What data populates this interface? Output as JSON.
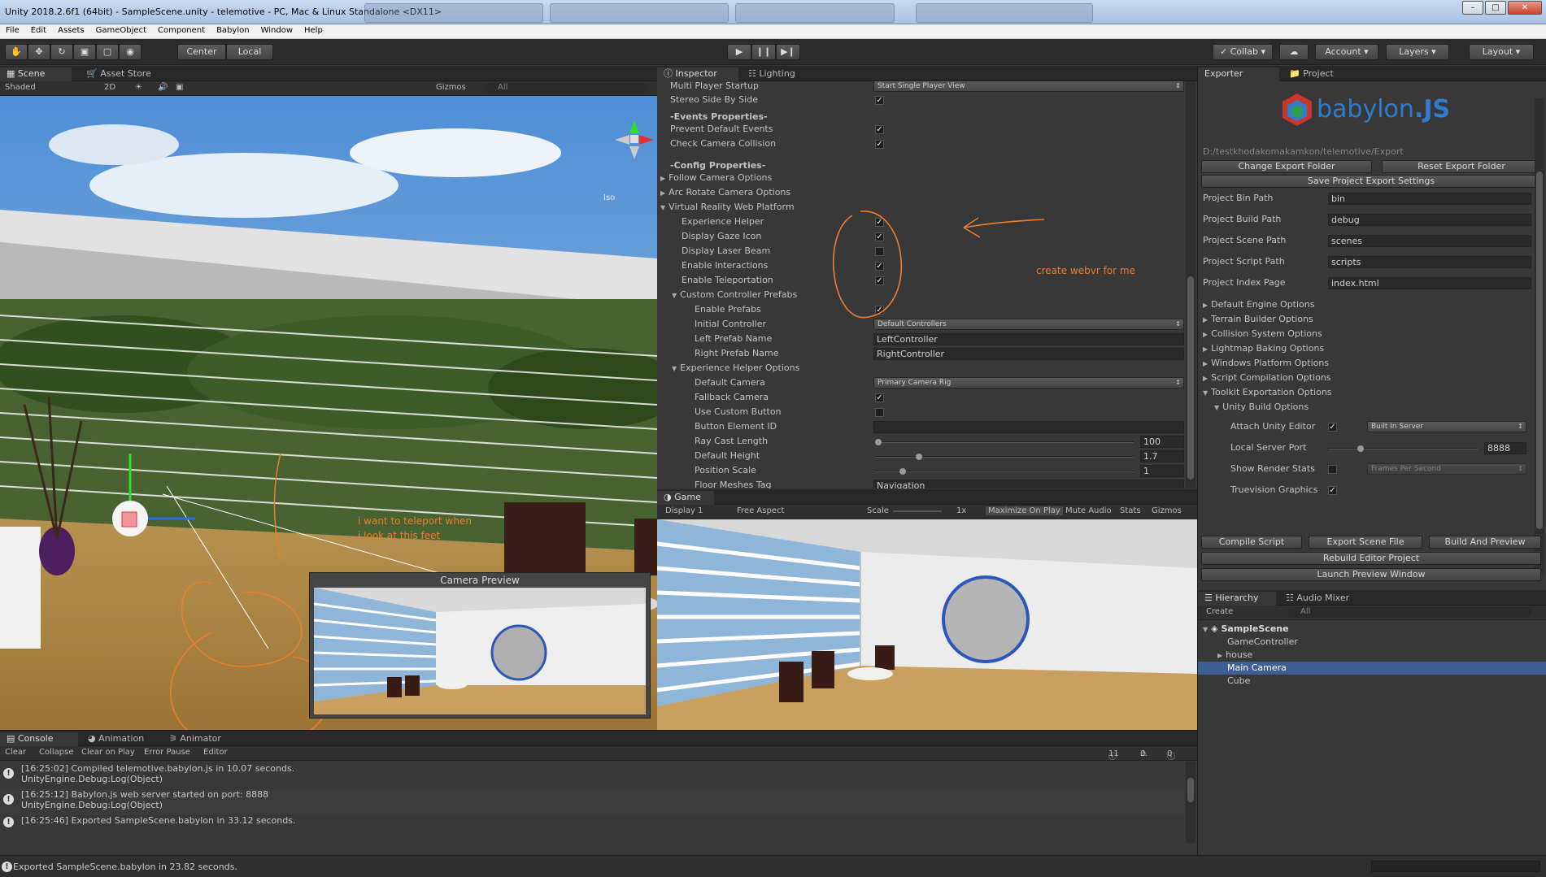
{
  "window": {
    "title": "Unity 2018.2.6f1 (64bit) - SampleScene.unity - telemotive - PC, Mac & Linux Standalone <DX11>"
  },
  "menu": [
    "File",
    "Edit",
    "Assets",
    "GameObject",
    "Component",
    "Babylon",
    "Window",
    "Help"
  ],
  "toolbar": {
    "pivot": "Center",
    "space": "Local",
    "collab": "Collab",
    "account": "Account",
    "layers": "Layers",
    "layout": "Layout"
  },
  "scene": {
    "tabs": [
      "Scene",
      "Asset Store"
    ],
    "shading": "Shaded",
    "mode_2d": "2D",
    "gizmos": "Gizmos",
    "search": "All",
    "iso_label": "Iso",
    "preview_title": "Camera Preview",
    "annotation": "i want to teleport when i look at this feet"
  },
  "inspector": {
    "tabs": [
      "Inspector",
      "Lighting"
    ],
    "annotation": "create webvr for me",
    "rows": {
      "multi_player": "Multi Player Startup",
      "multi_player_value": "Start Single Player View",
      "stereo": "Stereo Side By Side",
      "events_header": "-Events Properties-",
      "prevent_default": "Prevent Default Events",
      "check_camera": "Check Camera Collision",
      "config_header": "-Config Properties-",
      "follow_camera": "Follow Camera Options",
      "arc_rotate": "Arc Rotate Camera Options",
      "vr_web": "Virtual Reality Web Platform",
      "experience_helper": "Experience Helper",
      "gaze_icon": "Display Gaze Icon",
      "laser_beam": "Display Laser Beam",
      "interactions": "Enable Interactions",
      "teleportation": "Enable Teleportation",
      "custom_prefabs": "Custom Controller Prefabs",
      "enable_prefabs": "Enable Prefabs",
      "initial_controller": "Initial Controller",
      "initial_controller_value": "Default Controllers",
      "left_prefab": "Left Prefab Name",
      "left_prefab_value": "LeftController",
      "right_prefab": "Right Prefab Name",
      "right_prefab_value": "RightController",
      "helper_options": "Experience Helper Options",
      "default_camera": "Default Camera",
      "default_camera_value": "Primary Camera Rig",
      "fallback_camera": "Fallback Camera",
      "custom_button": "Use Custom Button",
      "button_id": "Button Element ID",
      "ray_cast": "Ray Cast Length",
      "ray_cast_value": "100",
      "default_height": "Default Height",
      "default_height_value": "1.7",
      "position_scale": "Position Scale",
      "position_scale_value": "1",
      "floor_meshes": "Floor Meshes Tag",
      "floor_meshes_value": "Navigation"
    }
  },
  "game": {
    "tab": "Game",
    "display": "Display 1",
    "aspect": "Free Aspect",
    "scale_label": "Scale",
    "scale_value": "1x",
    "maximize": "Maximize On Play",
    "mute": "Mute Audio",
    "stats": "Stats",
    "gizmos": "Gizmos"
  },
  "exporter": {
    "tabs": [
      "Exporter",
      "Project"
    ],
    "logo_a": "babylon",
    "logo_b": ".JS",
    "export_path": "D:/testkhodakomakamkon/telemotive/Export",
    "change_folder": "Change Export Folder",
    "reset_folder": "Reset Export Folder",
    "save_settings": "Save Project Export Settings",
    "fields": [
      {
        "label": "Project Bin Path",
        "value": "bin"
      },
      {
        "label": "Project Build Path",
        "value": "debug"
      },
      {
        "label": "Project Scene Path",
        "value": "scenes"
      },
      {
        "label": "Project Script Path",
        "value": "scripts"
      },
      {
        "label": "Project Index Page",
        "value": "index.html"
      }
    ],
    "sections": [
      "Default Engine Options",
      "Terrain Builder Options",
      "Collision System Options",
      "Lightmap Baking Options",
      "Windows Platform Options",
      "Script Compilation Options",
      "Toolkit Exportation Options"
    ],
    "unity_build": "Unity Build Options",
    "attach_editor": "Attach Unity Editor",
    "attach_value": "Built In Server",
    "local_port": "Local Server Port",
    "local_port_value": "8888",
    "render_stats": "Show Render Stats",
    "render_stats_value": "Frames Per Second",
    "truevision": "Truevision Graphics",
    "compile": "Compile Script",
    "export_scene": "Export Scene File",
    "build_preview": "Build And Preview",
    "rebuild": "Rebuild Editor Project",
    "launch": "Launch Preview Window"
  },
  "hierarchy": {
    "tabs": [
      "Hierarchy",
      "Audio Mixer"
    ],
    "create": "Create",
    "search": "All",
    "scene": "SampleScene",
    "items": [
      "GameController",
      "house",
      "Main Camera",
      "Cube"
    ]
  },
  "console": {
    "tabs": [
      "Console",
      "Animation",
      "Animator"
    ],
    "clear": "Clear",
    "collapse": "Collapse",
    "clear_play": "Clear on Play",
    "error_pause": "Error Pause",
    "editor": "Editor",
    "count_info": "11",
    "count_warn": "0",
    "count_err": "0",
    "logs": [
      {
        "line1": "[16:25:02] Compiled telemotive.babylon.js in 10.07 seconds.",
        "line2": "UnityEngine.Debug:Log(Object)"
      },
      {
        "line1": "[16:25:12] Babylon.js web server started on port: 8888",
        "line2": "UnityEngine.Debug:Log(Object)"
      },
      {
        "line1": "[16:25:46] Exported SampleScene.babylon in 33.12 seconds.",
        "line2": ""
      }
    ]
  },
  "status": {
    "text": "Exported SampleScene.babylon in 23.82 seconds."
  }
}
